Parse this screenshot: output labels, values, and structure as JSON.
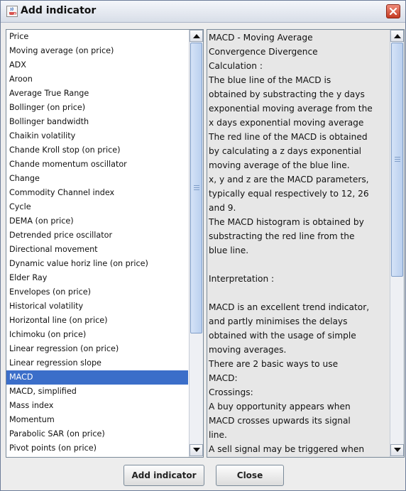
{
  "window": {
    "title": "Add indicator"
  },
  "indicators": [
    "Price",
    "Moving average (on price)",
    "ADX",
    "Aroon",
    "Average True Range",
    "Bollinger (on price)",
    "Bollinger bandwidth",
    "Chaikin volatility",
    "Chande Kroll stop (on price)",
    "Chande momentum oscillator",
    "Change",
    "Commodity Channel index",
    "Cycle",
    "DEMA (on price)",
    "Detrended price oscillator",
    "Directional movement",
    "Dynamic value horiz line (on price)",
    "Elder Ray",
    "Envelopes (on price)",
    "Historical volatility",
    "Horizontal line (on price)",
    "Ichimoku (on price)",
    "Linear regression (on price)",
    "Linear regression slope",
    "MACD",
    "MACD, simplified",
    "Mass index",
    "Momentum",
    "Parabolic SAR (on price)",
    "Pivot points (on price)"
  ],
  "selected_indicator": "MACD",
  "description_lines": [
    "MACD - Moving Average",
    "Convergence Divergence",
    " Calculation :",
    "The blue line of the MACD is",
    "obtained by substracting the y days",
    "exponential moving average from the",
    "x days exponential moving average",
    "The red line of the MACD is obtained",
    "by calculating a z days exponential",
    "moving average of the blue line.",
    "x, y and z are the MACD parameters,",
    "typically equal respectively to 12, 26",
    "and 9.",
    "The MACD histogram is obtained by",
    "substracting the red line from the",
    "blue line.",
    "",
    "Interpretation :",
    "",
    "MACD is an excellent trend indicator,",
    "and partly minimises the delays",
    "obtained with the usage of simple",
    "moving averages.",
    "There are 2 basic ways to use",
    "MACD:",
    " Crossings:",
    "A buy opportunity appears when",
    "MACD crosses upwards its signal",
    "line.",
    "A sell signal may be triggered when"
  ],
  "buttons": {
    "add": "Add indicator",
    "close": "Close"
  },
  "icons": {
    "app": "java-cup-icon",
    "close": "close-x-icon",
    "scroll_up": "arrow-up-icon",
    "scroll_down": "arrow-down-icon"
  },
  "colors": {
    "selection": "#3b6ec9",
    "close_button": "#c43a22"
  }
}
